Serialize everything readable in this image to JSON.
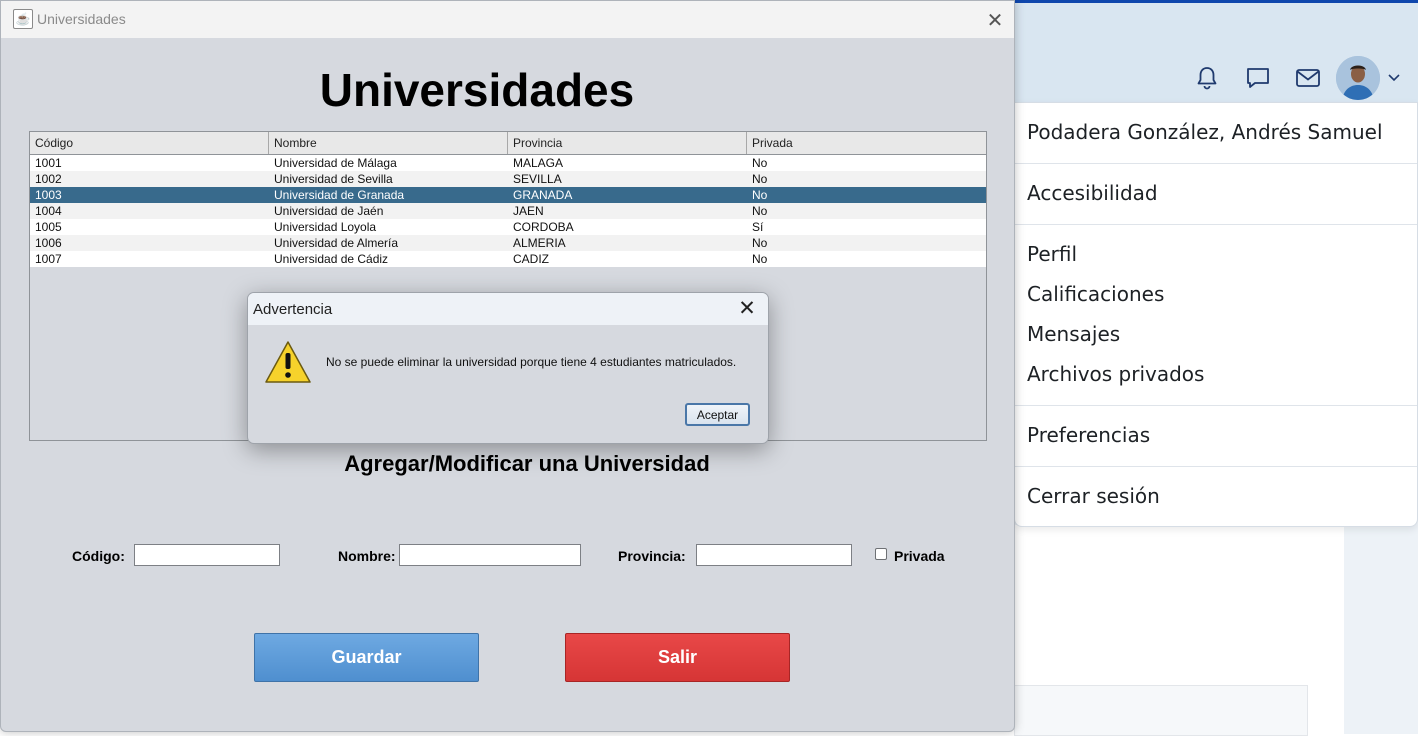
{
  "window": {
    "title": "Universidades",
    "close_glyph": "✕",
    "heading": "Universidades"
  },
  "table": {
    "columns": [
      "Código",
      "Nombre",
      "Provincia",
      "Privada"
    ],
    "rows": [
      [
        "1001",
        "Universidad de Málaga",
        "MALAGA",
        "No"
      ],
      [
        "1002",
        "Universidad de Sevilla",
        "SEVILLA",
        "No"
      ],
      [
        "1003",
        "Universidad de Granada",
        "GRANADA",
        "No"
      ],
      [
        "1004",
        "Universidad de Jaén",
        "JAEN",
        "No"
      ],
      [
        "1005",
        "Universidad Loyola",
        "CORDOBA",
        "Sí"
      ],
      [
        "1006",
        "Universidad de Almería",
        "ALMERIA",
        "No"
      ],
      [
        "1007",
        "Universidad de Cádiz",
        "CADIZ",
        "No"
      ]
    ],
    "selected_row": 2
  },
  "form": {
    "heading": "Agregar/Modificar una Universidad",
    "codigo_label": "Código:",
    "nombre_label": "Nombre:",
    "provincia_label": "Provincia:",
    "privada_label": "Privada",
    "codigo_value": "",
    "nombre_value": "",
    "provincia_value": "",
    "privada_checked": false,
    "save_label": "Guardar",
    "exit_label": "Salir"
  },
  "dialog": {
    "title": "Advertencia",
    "message": "No se puede eliminar la universidad porque tiene 4 estudiantes matriculados.",
    "ok_label": "Aceptar",
    "icon": "warning-icon"
  },
  "background_page": {
    "header_icons": [
      "bell-icon",
      "chat-icon",
      "mail-icon"
    ],
    "user_menu": {
      "user_name": "Podadera González, Andrés Samuel",
      "items_group1": [
        "Accesibilidad"
      ],
      "items_group2": [
        "Perfil",
        "Calificaciones",
        "Mensajes",
        "Archivos privados"
      ],
      "items_group3": [
        "Preferencias"
      ],
      "items_group4": [
        "Cerrar sesión"
      ]
    }
  },
  "colors": {
    "save_button": "#5b9bd8",
    "exit_button": "#dc3d3d",
    "selected_row": "#386a8c",
    "brand_strip": "#0f47ad"
  }
}
